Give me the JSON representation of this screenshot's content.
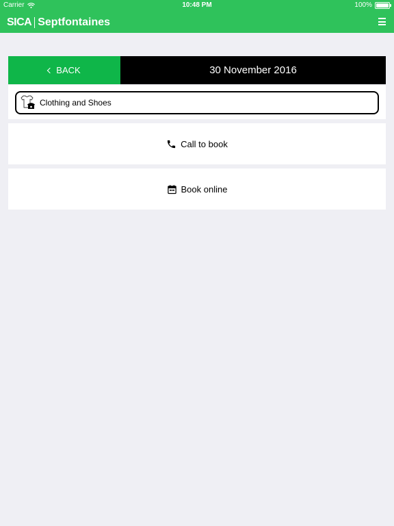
{
  "status_bar": {
    "carrier": "Carrier",
    "time": "10:48 PM",
    "battery": "100%"
  },
  "header": {
    "logo_brand": "SICA",
    "logo_city": "Septfontaines"
  },
  "datebar": {
    "back_label": "BACK",
    "date": "30 November 2016"
  },
  "category": {
    "label": "Clothing and Shoes"
  },
  "actions": {
    "call_label": "Call to book",
    "online_label": "Book online"
  },
  "colors": {
    "header_bg": "#2fc25b",
    "back_bg": "#0fb649",
    "date_bg": "#000000",
    "page_bg": "#efeff4"
  }
}
